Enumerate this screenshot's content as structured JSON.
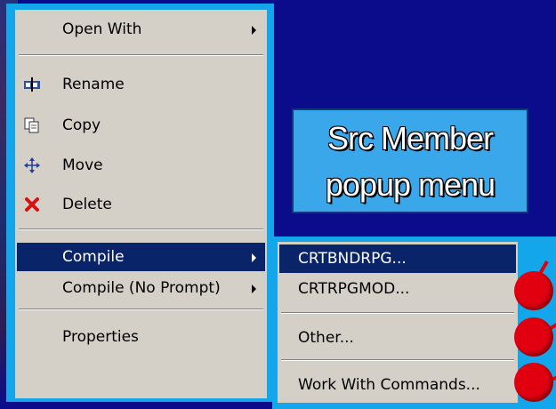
{
  "menu": {
    "items": [
      {
        "label": "Open With",
        "icon": "none",
        "arrow": true
      },
      {
        "label": "Rename",
        "icon": "rename-icon"
      },
      {
        "label": "Copy",
        "icon": "copy-icon"
      },
      {
        "label": "Move",
        "icon": "move-icon"
      },
      {
        "label": "Delete",
        "icon": "delete-icon"
      },
      {
        "label": "Compile",
        "icon": "none",
        "arrow": true,
        "selected": true
      },
      {
        "label": "Compile (No Prompt)",
        "icon": "none",
        "arrow": true
      },
      {
        "label": "Properties",
        "icon": "none"
      }
    ]
  },
  "submenu": {
    "items": [
      {
        "label": "CRTBNDRPG...",
        "selected": true
      },
      {
        "label": "CRTRPGMOD..."
      },
      {
        "label": "Other..."
      },
      {
        "label": "Work With Commands..."
      }
    ]
  },
  "callout": {
    "line1": "Src Member",
    "line2": "popup menu"
  },
  "colors": {
    "frame": "#13a6ea",
    "menu_bg": "#d4d0c8",
    "highlight": "#0a246a",
    "dot": "#e00010",
    "background": "#0a0c8c"
  }
}
